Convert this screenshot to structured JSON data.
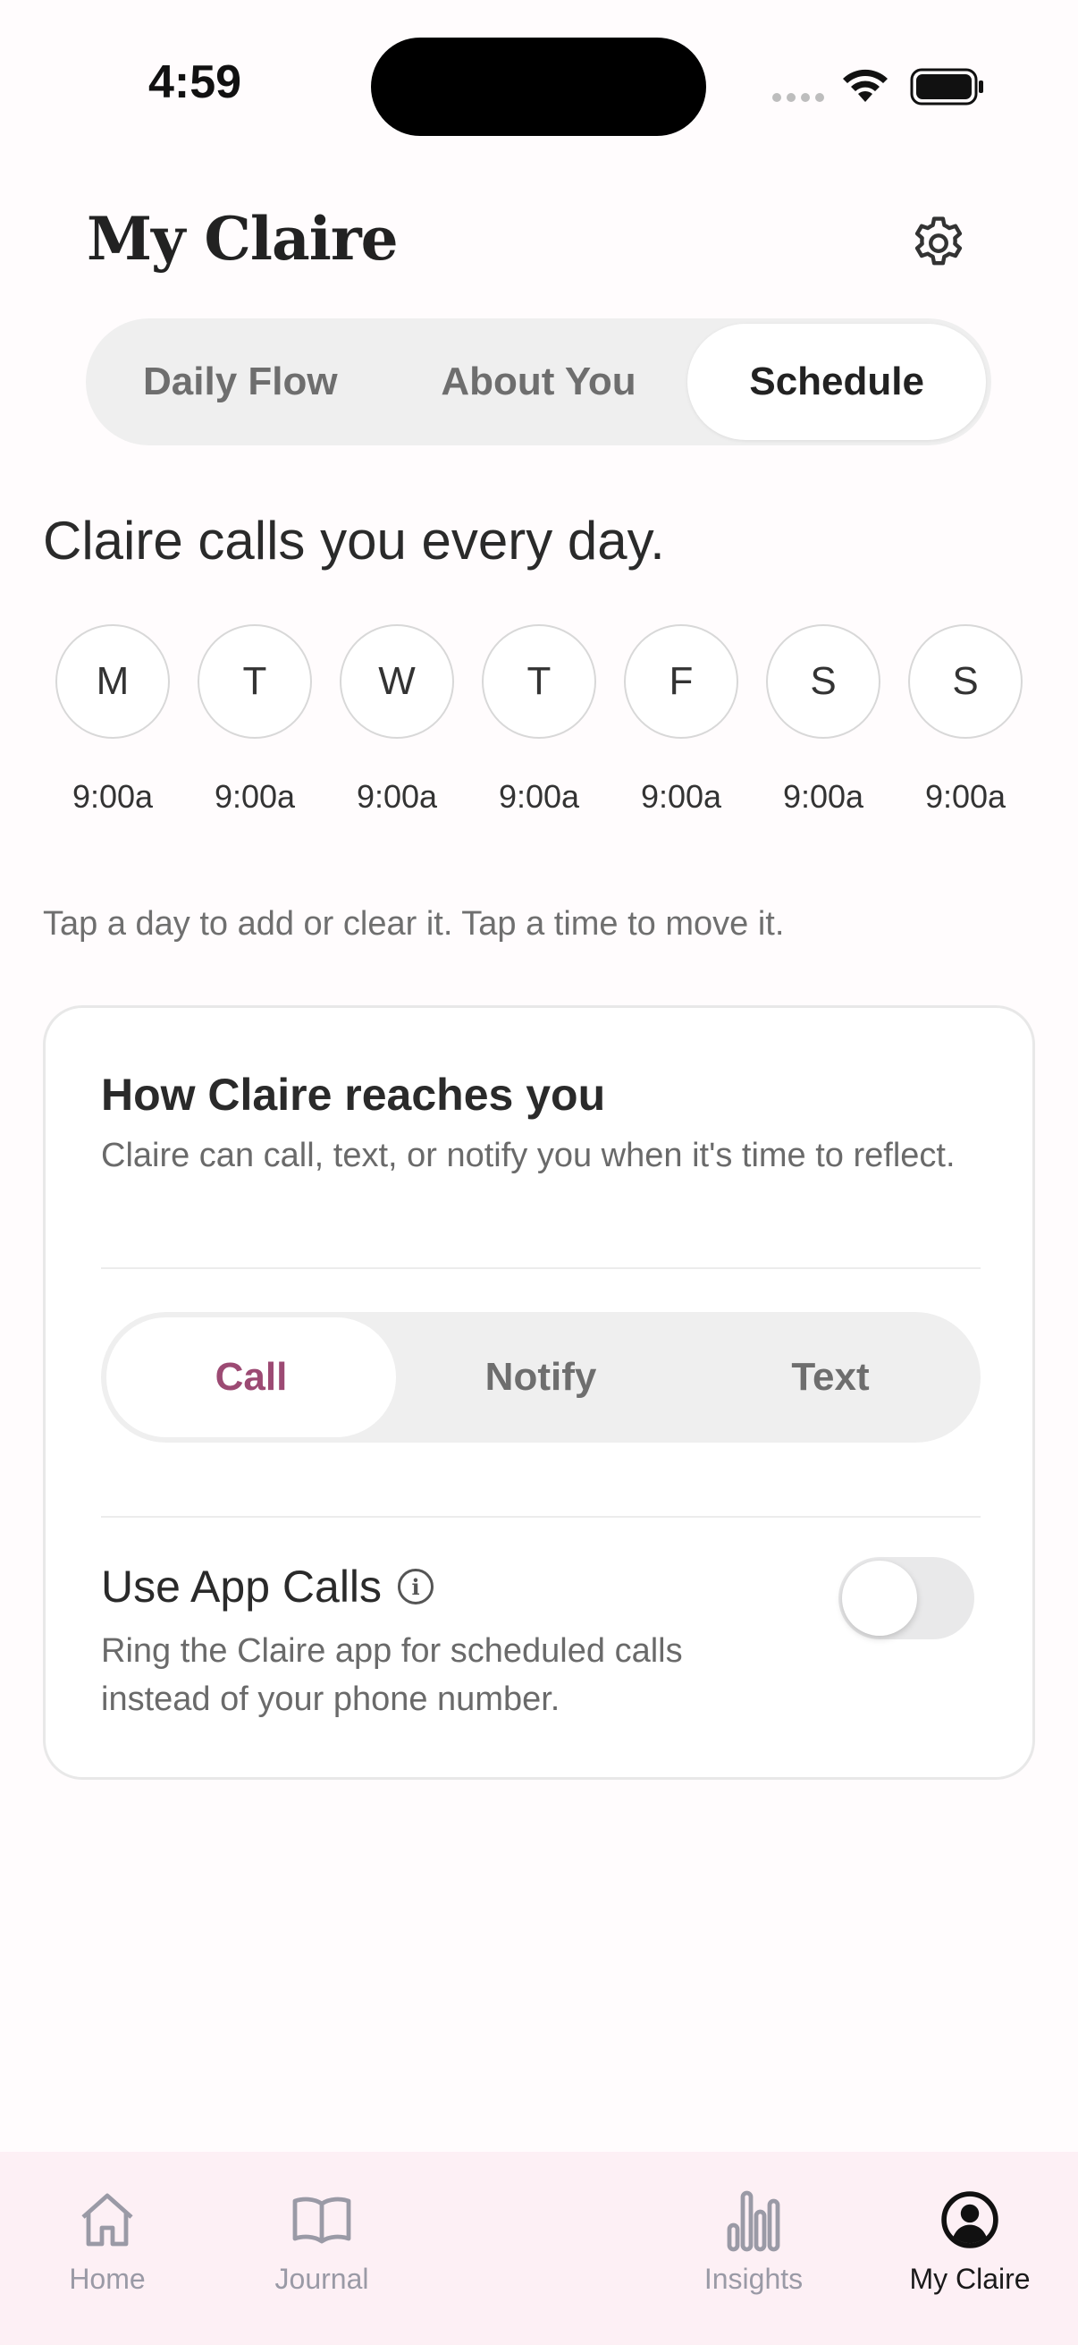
{
  "status_bar": {
    "time": "4:59"
  },
  "header": {
    "title": "My Claire"
  },
  "top_tabs": [
    {
      "label": "Daily Flow",
      "active": false
    },
    {
      "label": "About You",
      "active": false
    },
    {
      "label": "Schedule",
      "active": true
    }
  ],
  "schedule": {
    "headline": "Claire calls you every day.",
    "days": [
      {
        "letter": "M",
        "time": "9:00a"
      },
      {
        "letter": "T",
        "time": "9:00a"
      },
      {
        "letter": "W",
        "time": "9:00a"
      },
      {
        "letter": "T",
        "time": "9:00a"
      },
      {
        "letter": "F",
        "time": "9:00a"
      },
      {
        "letter": "S",
        "time": "9:00a"
      },
      {
        "letter": "S",
        "time": "9:00a"
      }
    ],
    "hint": "Tap a day to add or clear it. Tap a time to move it."
  },
  "reach_card": {
    "title": "How Claire reaches you",
    "description": "Claire can call, text, or notify you when it's time to reflect.",
    "modes": [
      {
        "label": "Call",
        "active": true
      },
      {
        "label": "Notify",
        "active": false
      },
      {
        "label": "Text",
        "active": false
      }
    ],
    "app_calls": {
      "title": "Use App Calls",
      "description": "Ring the Claire app for scheduled calls instead of your phone number.",
      "enabled": false
    }
  },
  "bottom_nav": {
    "home": "Home",
    "journal": "Journal",
    "insights": "Insights",
    "my_claire": "My Claire"
  },
  "colors": {
    "accent": "#9c4a73",
    "nav_background": "#fdf0f5",
    "inactive_nav": "#9a9aa6"
  }
}
